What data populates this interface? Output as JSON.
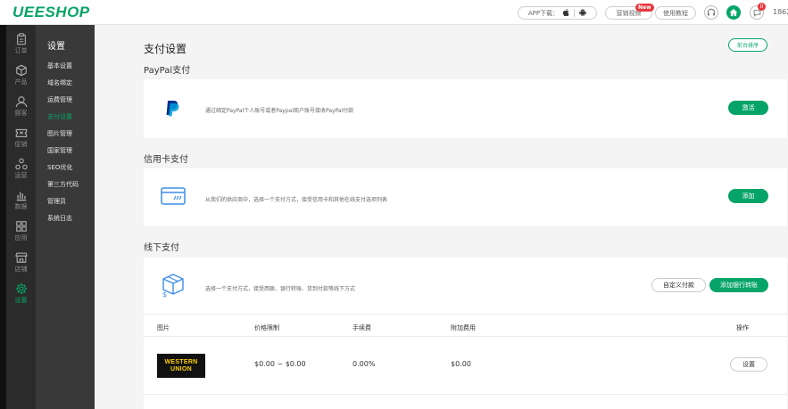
{
  "topbar": {
    "logo": "UEESHOP",
    "app_download": "APP下载：",
    "apple_icon": "apple-icon",
    "android_icon": "android-icon",
    "marketing_video": "营销视频",
    "new_badge": "New",
    "tutorial": "使用教程",
    "message_count": "0",
    "user_prefix": "1862",
    "accent": "#06a468"
  },
  "leftnav": {
    "items": [
      {
        "label": "订单",
        "icon": "clipboard-icon"
      },
      {
        "label": "产品",
        "icon": "cube-icon"
      },
      {
        "label": "顾客",
        "icon": "user-icon"
      },
      {
        "label": "促销",
        "icon": "ticket-icon"
      },
      {
        "label": "运营",
        "icon": "nodes-icon"
      },
      {
        "label": "数据",
        "icon": "bar-chart-icon"
      },
      {
        "label": "应用",
        "icon": "grid-icon"
      },
      {
        "label": "店铺",
        "icon": "store-icon"
      },
      {
        "label": "设置",
        "icon": "gear-icon",
        "active": true
      }
    ]
  },
  "subnav": {
    "title": "设置",
    "items": [
      {
        "label": "基本设置"
      },
      {
        "label": "域名绑定"
      },
      {
        "label": "运费管理"
      },
      {
        "label": "支付设置",
        "active": true
      },
      {
        "label": "图片管理"
      },
      {
        "label": "国家管理"
      },
      {
        "label": "SEO优化"
      },
      {
        "label": "第三方代码"
      },
      {
        "label": "管理员"
      },
      {
        "label": "系统日志"
      }
    ]
  },
  "main": {
    "title": "支付设置",
    "sort_button": "前台排序",
    "paypal": {
      "section_title": "PayPal支付",
      "description": "通过绑定PayPal个人账号或者Paypal商户账号接收PayPal付款",
      "button": "激活"
    },
    "credit": {
      "section_title": "信用卡支付",
      "description": "从我们的供应商中，选择一个支付方式，接受信用卡和其他在线支付选项列表",
      "button": "添加"
    },
    "offline": {
      "section_title": "线下支付",
      "description": "选择一个支付方式，接受西联、银行转账、货到付款等线下方式",
      "custom_button": "自定义付款",
      "add_bank_button": "添加银行转账",
      "columns": [
        "图片",
        "价格限制",
        "手续费",
        "附加费用",
        "操作"
      ],
      "rows": [
        {
          "logo_line1": "WESTERN",
          "logo_line2": "UNION",
          "price_limit": "$0.00 ~ $0.00",
          "fee": "0.00%",
          "extra": "$0.00",
          "action": "设置"
        }
      ]
    }
  }
}
